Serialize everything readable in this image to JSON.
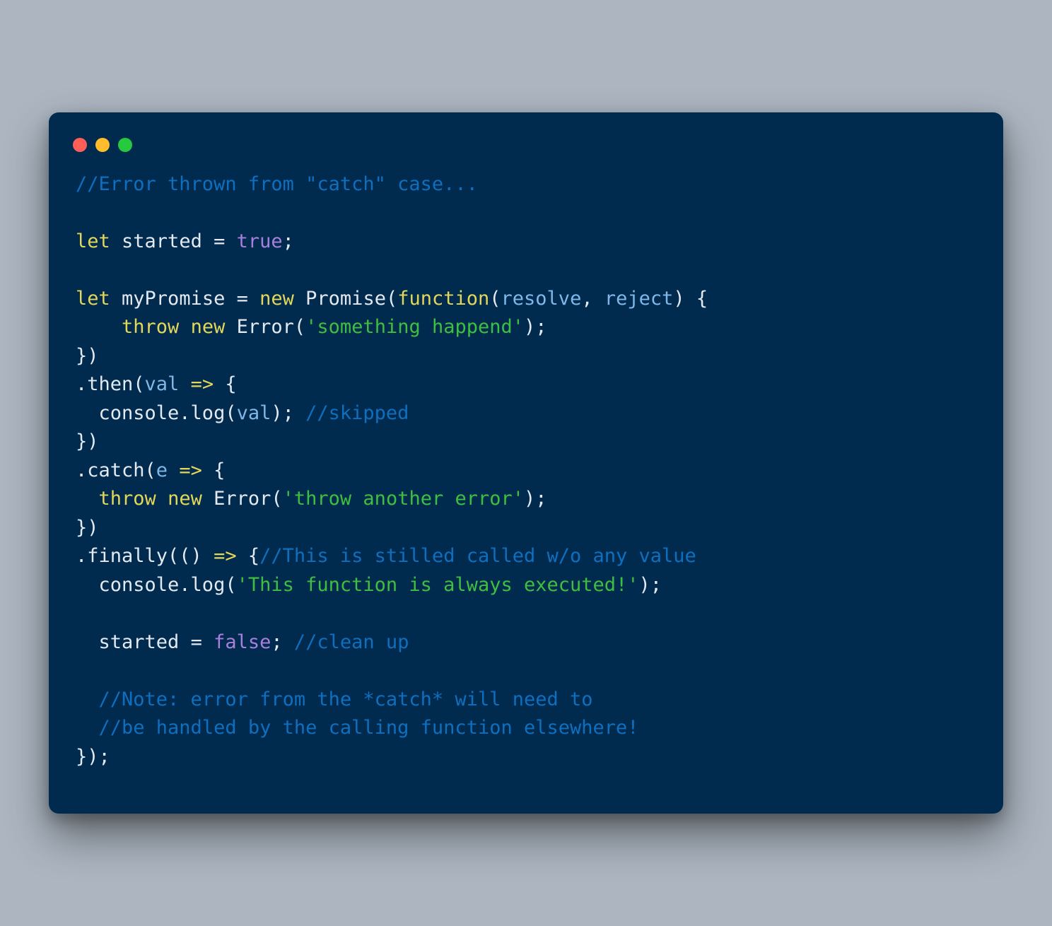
{
  "window": {
    "dots": [
      "red",
      "yellow",
      "green"
    ]
  },
  "code": {
    "lines": [
      [
        {
          "cls": "c-comment",
          "t": "//Error thrown from \"catch\" case..."
        }
      ],
      [],
      [
        {
          "cls": "c-keyword",
          "t": "let"
        },
        {
          "cls": "c-plain",
          "t": " started "
        },
        {
          "cls": "c-plain",
          "t": "="
        },
        {
          "cls": "c-plain",
          "t": " "
        },
        {
          "cls": "c-bool",
          "t": "true"
        },
        {
          "cls": "c-plain",
          "t": ";"
        }
      ],
      [],
      [
        {
          "cls": "c-keyword",
          "t": "let"
        },
        {
          "cls": "c-plain",
          "t": " myPromise "
        },
        {
          "cls": "c-plain",
          "t": "="
        },
        {
          "cls": "c-plain",
          "t": " "
        },
        {
          "cls": "c-keyword",
          "t": "new"
        },
        {
          "cls": "c-plain",
          "t": " Promise("
        },
        {
          "cls": "c-keyword",
          "t": "function"
        },
        {
          "cls": "c-plain",
          "t": "("
        },
        {
          "cls": "c-arg",
          "t": "resolve"
        },
        {
          "cls": "c-plain",
          "t": ", "
        },
        {
          "cls": "c-arg",
          "t": "reject"
        },
        {
          "cls": "c-plain",
          "t": ") {"
        }
      ],
      [
        {
          "cls": "c-plain",
          "t": "    "
        },
        {
          "cls": "c-keyword",
          "t": "throw"
        },
        {
          "cls": "c-plain",
          "t": " "
        },
        {
          "cls": "c-keyword",
          "t": "new"
        },
        {
          "cls": "c-plain",
          "t": " Error("
        },
        {
          "cls": "c-string",
          "t": "'something happend'"
        },
        {
          "cls": "c-plain",
          "t": ");"
        }
      ],
      [
        {
          "cls": "c-plain",
          "t": "})"
        }
      ],
      [
        {
          "cls": "c-plain",
          "t": ".then("
        },
        {
          "cls": "c-arg",
          "t": "val"
        },
        {
          "cls": "c-plain",
          "t": " "
        },
        {
          "cls": "c-keyword",
          "t": "=>"
        },
        {
          "cls": "c-plain",
          "t": " {"
        }
      ],
      [
        {
          "cls": "c-plain",
          "t": "  console.log("
        },
        {
          "cls": "c-arg",
          "t": "val"
        },
        {
          "cls": "c-plain",
          "t": "); "
        },
        {
          "cls": "c-comment",
          "t": "//skipped"
        }
      ],
      [
        {
          "cls": "c-plain",
          "t": "})"
        }
      ],
      [
        {
          "cls": "c-plain",
          "t": ".catch("
        },
        {
          "cls": "c-arg",
          "t": "e"
        },
        {
          "cls": "c-plain",
          "t": " "
        },
        {
          "cls": "c-keyword",
          "t": "=>"
        },
        {
          "cls": "c-plain",
          "t": " {"
        }
      ],
      [
        {
          "cls": "c-plain",
          "t": "  "
        },
        {
          "cls": "c-keyword",
          "t": "throw"
        },
        {
          "cls": "c-plain",
          "t": " "
        },
        {
          "cls": "c-keyword",
          "t": "new"
        },
        {
          "cls": "c-plain",
          "t": " Error("
        },
        {
          "cls": "c-string",
          "t": "'throw another error'"
        },
        {
          "cls": "c-plain",
          "t": ");"
        }
      ],
      [
        {
          "cls": "c-plain",
          "t": "})"
        }
      ],
      [
        {
          "cls": "c-plain",
          "t": ".finally(() "
        },
        {
          "cls": "c-keyword",
          "t": "=>"
        },
        {
          "cls": "c-plain",
          "t": " {"
        },
        {
          "cls": "c-comment",
          "t": "//This is stilled called w/o any value"
        }
      ],
      [
        {
          "cls": "c-plain",
          "t": "  console.log("
        },
        {
          "cls": "c-string",
          "t": "'This function is always executed!'"
        },
        {
          "cls": "c-plain",
          "t": ");"
        }
      ],
      [],
      [
        {
          "cls": "c-plain",
          "t": "  started "
        },
        {
          "cls": "c-plain",
          "t": "="
        },
        {
          "cls": "c-plain",
          "t": " "
        },
        {
          "cls": "c-bool",
          "t": "false"
        },
        {
          "cls": "c-plain",
          "t": "; "
        },
        {
          "cls": "c-comment",
          "t": "//clean up"
        }
      ],
      [],
      [
        {
          "cls": "c-plain",
          "t": "  "
        },
        {
          "cls": "c-comment",
          "t": "//Note: error from the *catch* will need to"
        }
      ],
      [
        {
          "cls": "c-plain",
          "t": "  "
        },
        {
          "cls": "c-comment",
          "t": "//be handled by the calling function elsewhere!"
        }
      ],
      [
        {
          "cls": "c-plain",
          "t": "});"
        }
      ]
    ]
  }
}
